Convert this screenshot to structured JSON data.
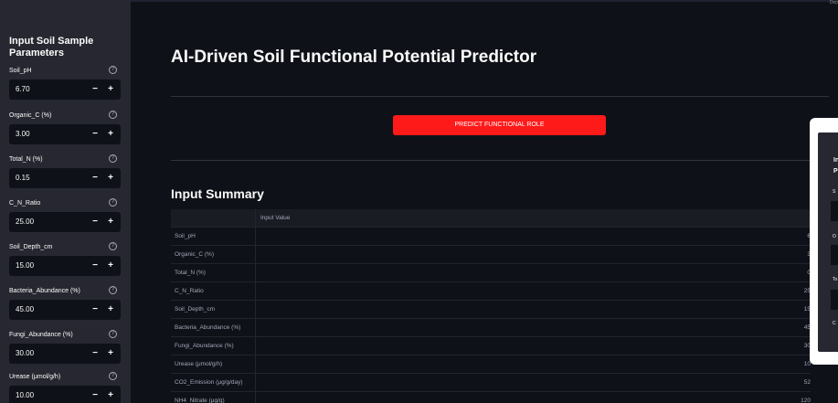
{
  "sidebar": {
    "title": "Input Soil Sample Parameters",
    "help_glyph": "?",
    "minus_glyph": "−",
    "plus_glyph": "+",
    "params": [
      {
        "label": "Soil_pH",
        "value": "6.70"
      },
      {
        "label": "Organic_C (%)",
        "value": "3.00"
      },
      {
        "label": "Total_N (%)",
        "value": "0.15"
      },
      {
        "label": "C_N_Ratio",
        "value": "25.00"
      },
      {
        "label": "Soil_Depth_cm",
        "value": "15.00"
      },
      {
        "label": "Bacteria_Abundance (%)",
        "value": "45.00"
      },
      {
        "label": "Fungi_Abundance (%)",
        "value": "30.00"
      },
      {
        "label": "Urease (μmol/g/h)",
        "value": "10.00"
      }
    ]
  },
  "main": {
    "title": "AI-Driven Soil Functional Potential Predictor",
    "predict_button": "PREDICT FUNCTIONAL ROLE",
    "section_title": "Input Summary",
    "table": {
      "header": [
        "",
        "Input Value"
      ],
      "rows": [
        {
          "name": "Soil_pH",
          "value": "6"
        },
        {
          "name": "Organic_C (%)",
          "value": "3"
        },
        {
          "name": "Total_N (%)",
          "value": "0"
        },
        {
          "name": "C_N_Ratio",
          "value": "25"
        },
        {
          "name": "Soil_Depth_cm",
          "value": "15"
        },
        {
          "name": "Bacteria_Abundance (%)",
          "value": "45"
        },
        {
          "name": "Fungi_Abundance (%)",
          "value": "30"
        },
        {
          "name": "Urease (μmol/g/h)",
          "value": "10"
        },
        {
          "name": "CO2_Emission (μg/g/day)",
          "value": "52"
        },
        {
          "name": "NH4_Nitrate (μg/g)",
          "value": "120"
        }
      ]
    }
  },
  "popup": {
    "line1": "In",
    "line2": "P",
    "labels": [
      "S",
      "O",
      "To",
      "C"
    ]
  },
  "corner": "Dep"
}
